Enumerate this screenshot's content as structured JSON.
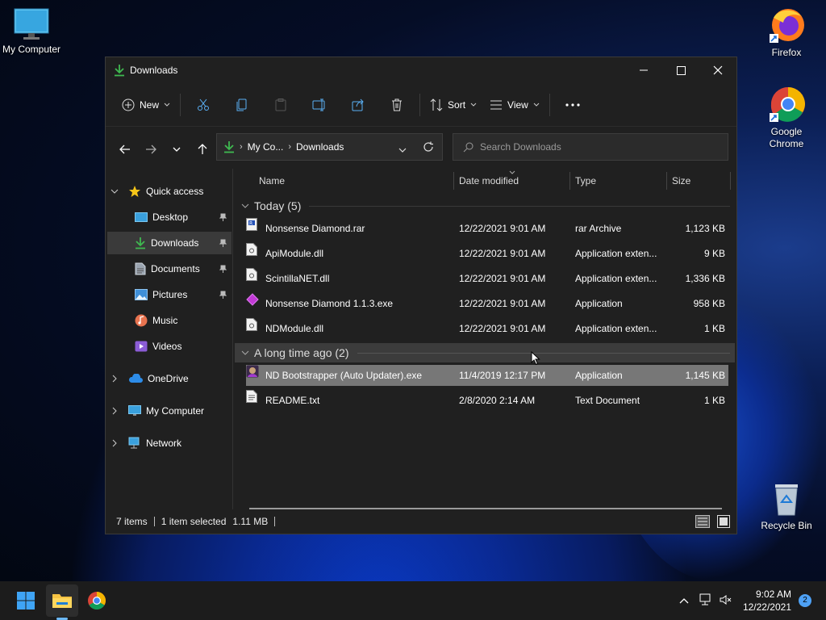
{
  "desktop": {
    "icons": [
      {
        "label": "My Computer"
      },
      {
        "label": "Firefox"
      },
      {
        "label": "Google Chrome"
      },
      {
        "label": "Recycle Bin"
      }
    ]
  },
  "window": {
    "title": "Downloads",
    "commands": {
      "new_label": "New",
      "sort_label": "Sort",
      "view_label": "View"
    },
    "address": {
      "crumb1": "My Co...",
      "crumb2": "Downloads"
    },
    "search": {
      "placeholder": "Search Downloads"
    },
    "sidebar": {
      "quick_access": "Quick access",
      "items": [
        {
          "label": "Desktop"
        },
        {
          "label": "Downloads"
        },
        {
          "label": "Documents"
        },
        {
          "label": "Pictures"
        },
        {
          "label": "Music"
        },
        {
          "label": "Videos"
        }
      ],
      "onedrive": "OneDrive",
      "my_computer": "My Computer",
      "network": "Network"
    },
    "columns": {
      "name": "Name",
      "date": "Date modified",
      "type": "Type",
      "size": "Size"
    },
    "groups": [
      {
        "label": "Today (5)",
        "files": [
          {
            "name": "Nonsense Diamond.rar",
            "date": "12/22/2021 9:01 AM",
            "type": "rar Archive",
            "size": "1,123 KB"
          },
          {
            "name": "ApiModule.dll",
            "date": "12/22/2021 9:01 AM",
            "type": "Application exten...",
            "size": "9 KB"
          },
          {
            "name": "ScintillaNET.dll",
            "date": "12/22/2021 9:01 AM",
            "type": "Application exten...",
            "size": "1,336 KB"
          },
          {
            "name": "Nonsense Diamond 1.1.3.exe",
            "date": "12/22/2021 9:01 AM",
            "type": "Application",
            "size": "958 KB"
          },
          {
            "name": "NDModule.dll",
            "date": "12/22/2021 9:01 AM",
            "type": "Application exten...",
            "size": "1 KB"
          }
        ]
      },
      {
        "label": "A long time ago (2)",
        "files": [
          {
            "name": "ND Bootstrapper (Auto Updater).exe",
            "date": "11/4/2019 12:17 PM",
            "type": "Application",
            "size": "1,145 KB"
          },
          {
            "name": "README.txt",
            "date": "2/8/2020 2:14 AM",
            "type": "Text Document",
            "size": "1 KB"
          }
        ]
      }
    ],
    "status": {
      "items": "7 items",
      "selected": "1 item selected",
      "size": "1.11 MB"
    }
  },
  "taskbar": {
    "time": "9:02 AM",
    "date": "12/22/2021",
    "notifications": "2"
  },
  "colors": {
    "accent": "#4ea1f5",
    "window_bg": "#202020",
    "selected_row": "#777777",
    "download_green": "#3fb950"
  }
}
